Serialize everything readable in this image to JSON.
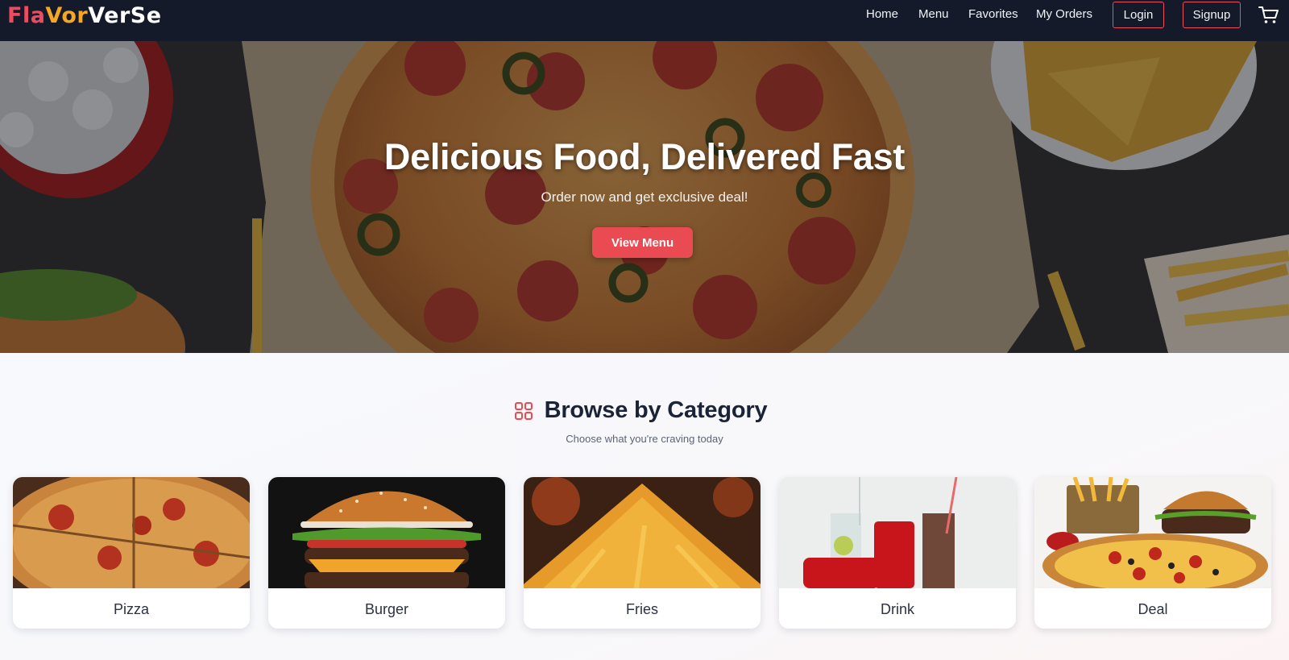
{
  "brand": {
    "logo_parts": [
      {
        "text": "Fla",
        "color": "#ef4b5e"
      },
      {
        "text": "Vor",
        "color": "#f5a623"
      },
      {
        "text": "VerSe",
        "color": "#ffffff"
      }
    ]
  },
  "nav": {
    "home": "Home",
    "menu": "Menu",
    "favorites": "Favorites",
    "orders": "My Orders",
    "login": "Login",
    "signup": "Signup",
    "cart_icon": "cart-icon"
  },
  "hero": {
    "title": "Delicious Food, Delivered Fast",
    "subtitle": "Order now and get exclusive deal!",
    "cta": "View Menu"
  },
  "categories": {
    "title": "Browse by Category",
    "subtitle": "Choose what you're craving today",
    "icon": "grid-icon",
    "items": [
      {
        "label": "Pizza"
      },
      {
        "label": "Burger"
      },
      {
        "label": "Fries"
      },
      {
        "label": "Drink"
      },
      {
        "label": "Deal"
      }
    ]
  },
  "colors": {
    "nav_bg": "#141a2a",
    "accent": "#ea4b52",
    "heading": "#1b2437"
  }
}
